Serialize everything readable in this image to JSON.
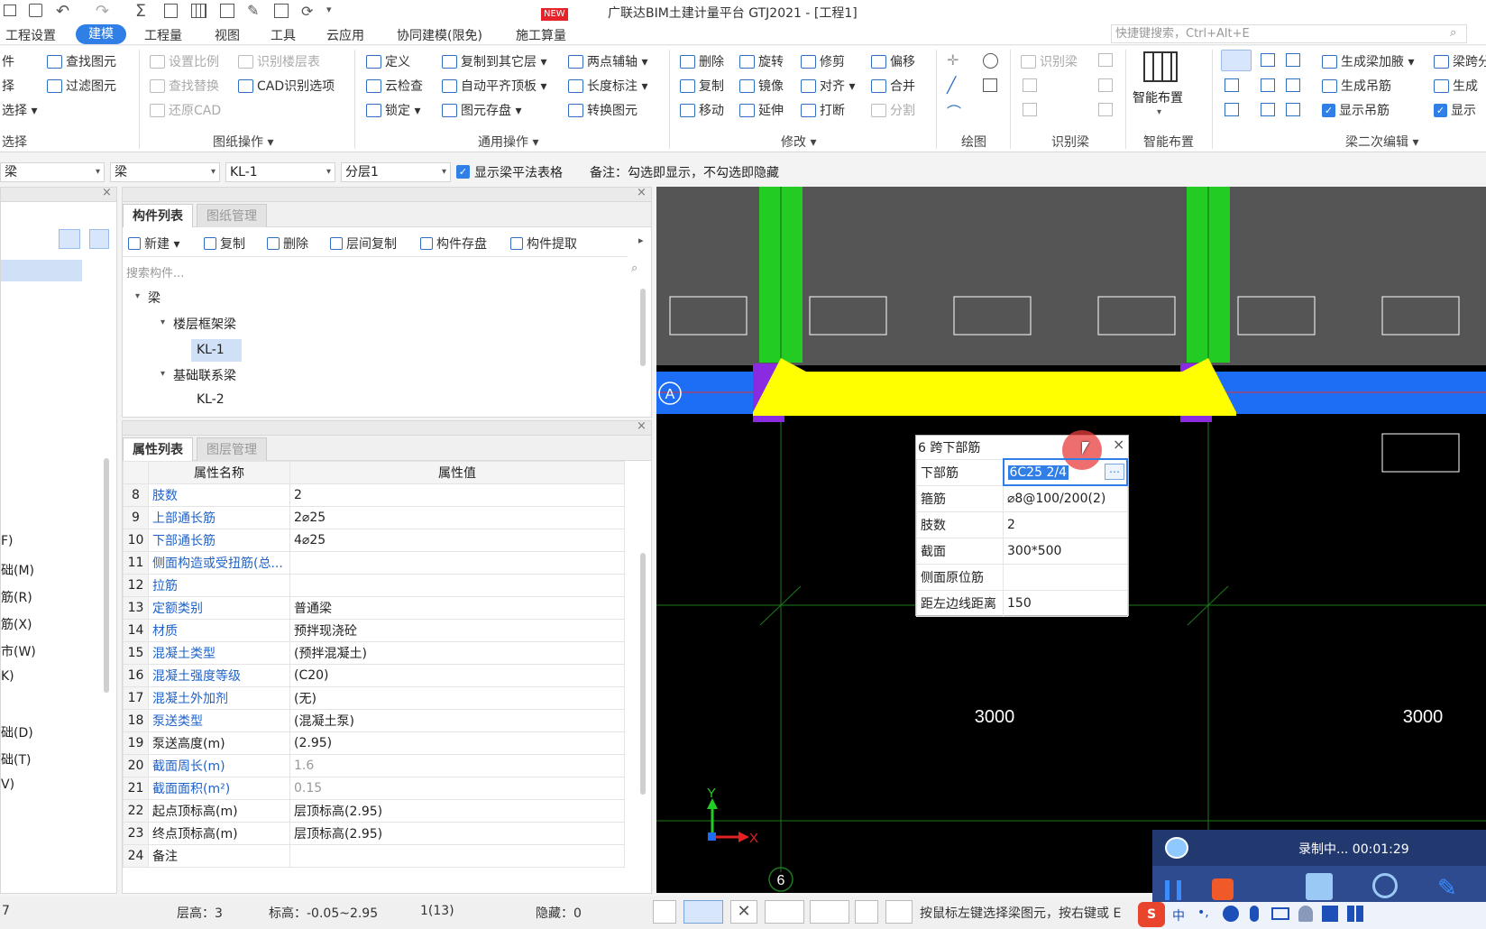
{
  "app": {
    "title": "广联达BIM土建计量平台 GTJ2021 - [工程1]",
    "new_badge": "NEW"
  },
  "menu": {
    "items": [
      "工程设置",
      "建模",
      "工程量",
      "视图",
      "工具",
      "云应用",
      "协同建模(限免)",
      "施工算量"
    ],
    "active": "建模",
    "search_placeholder": "快捷键搜索，Ctrl+Alt+E"
  },
  "ribbon": {
    "left_partial": [
      "件",
      "择",
      "选择 ▾",
      "选择"
    ],
    "find": [
      "查找图元",
      "过滤图元"
    ],
    "drawing_ops": {
      "items": [
        "设置比例",
        "识别楼层表",
        "查找替换",
        "CAD识别选项",
        "还原CAD"
      ],
      "label": "图纸操作 ▾"
    },
    "common_ops": {
      "items": [
        "定义",
        "复制到其它层 ▾",
        "两点辅轴 ▾",
        "云检查",
        "自动平齐顶板 ▾",
        "长度标注 ▾",
        "锁定 ▾",
        "图元存盘 ▾",
        "转换图元"
      ],
      "label": "通用操作 ▾"
    },
    "modify": {
      "items": [
        "删除",
        "旋转",
        "修剪",
        "偏移",
        "复制",
        "镜像",
        "对齐 ▾",
        "合并",
        "移动",
        "延伸",
        "打断",
        "分割"
      ],
      "label": "修改 ▾"
    },
    "draw": {
      "label": "绘图"
    },
    "recognize_beam": {
      "items": [
        "识别梁"
      ],
      "label": "识别梁"
    },
    "smart": {
      "button": "智能布置",
      "label": "智能布置"
    },
    "beam_edit": {
      "items": [
        "生成梁加腋 ▾",
        "梁跨分",
        "生成吊筋",
        "生成",
        "显示吊筋",
        "显示"
      ],
      "label": "梁二次编辑 ▾"
    }
  },
  "filterbar": {
    "combo1": "梁",
    "combo2": "梁",
    "combo3": "KL-1",
    "combo4": "分层1",
    "show_table_label": "显示梁平法表格",
    "note": "备注：勾选即显示，不勾选即隐藏"
  },
  "side_partial": [
    "F)",
    "础(M)",
    "筋(R)",
    "筋(X)",
    "市(W)",
    "K)",
    "础(D)",
    "础(T)",
    "V)"
  ],
  "component_panel": {
    "tabs": [
      "构件列表",
      "图纸管理"
    ],
    "tools": [
      "新建 ▾",
      "复制",
      "删除",
      "层间复制",
      "构件存盘",
      "构件提取"
    ],
    "search_placeholder": "搜索构件...",
    "tree": {
      "root": "梁",
      "groups": [
        {
          "name": "楼层框架梁",
          "children": [
            "KL-1"
          ]
        },
        {
          "name": "基础联系梁",
          "children": [
            "KL-2"
          ]
        }
      ],
      "selected": "KL-1"
    }
  },
  "property_panel": {
    "tabs": [
      "属性列表",
      "图层管理"
    ],
    "headers": [
      "属性名称",
      "属性值"
    ],
    "rows": [
      {
        "n": "8",
        "name": "肢数",
        "value": "2",
        "blue": true
      },
      {
        "n": "9",
        "name": "上部通长筋",
        "value": "2⌀25",
        "blue": true
      },
      {
        "n": "10",
        "name": "下部通长筋",
        "value": "4⌀25",
        "blue": true
      },
      {
        "n": "11",
        "name": "侧面构造或受扭筋(总...",
        "value": "",
        "blue": true
      },
      {
        "n": "12",
        "name": "拉筋",
        "value": "",
        "blue": true
      },
      {
        "n": "13",
        "name": "定额类别",
        "value": "普通梁",
        "blue": true
      },
      {
        "n": "14",
        "name": "材质",
        "value": "预拌现浇砼",
        "blue": true
      },
      {
        "n": "15",
        "name": "混凝土类型",
        "value": "(预拌混凝土)",
        "blue": true
      },
      {
        "n": "16",
        "name": "混凝土强度等级",
        "value": "(C20)",
        "blue": true
      },
      {
        "n": "17",
        "name": "混凝土外加剂",
        "value": "(无)",
        "blue": true
      },
      {
        "n": "18",
        "name": "泵送类型",
        "value": "(混凝土泵)",
        "blue": true
      },
      {
        "n": "19",
        "name": "泵送高度(m)",
        "value": "(2.95)",
        "blue": false
      },
      {
        "n": "20",
        "name": "截面周长(m)",
        "value": "1.6",
        "blue": true,
        "grey": true
      },
      {
        "n": "21",
        "name": "截面面积(m²)",
        "value": "0.15",
        "blue": true,
        "grey": true
      },
      {
        "n": "22",
        "name": "起点顶标高(m)",
        "value": "层顶标高(2.95)",
        "blue": false
      },
      {
        "n": "23",
        "name": "终点顶标高(m)",
        "value": "层顶标高(2.95)",
        "blue": false
      },
      {
        "n": "24",
        "name": "备注",
        "value": "",
        "blue": false
      }
    ]
  },
  "canvas": {
    "axis_label_a": "A",
    "axis_label_6": "6",
    "dim_left": "3000",
    "dim_right": "3000",
    "ucs_x": "X",
    "ucs_y": "Y",
    "colors": {
      "beam": "#ffff00",
      "column": "#22cc22",
      "wall": "#1e6ef5",
      "grid": "#1d7a1d",
      "support": "#8a2be2"
    }
  },
  "popup": {
    "title": "6 跨下部筋",
    "rows": [
      {
        "label": "下部筋",
        "value": "6C25 2/4",
        "editing": true
      },
      {
        "label": "箍筋",
        "value": "⌀8@100/200(2)"
      },
      {
        "label": "肢数",
        "value": "2"
      },
      {
        "label": "截面",
        "value": "300*500"
      },
      {
        "label": "侧面原位筋",
        "value": ""
      },
      {
        "label": "距左边线距离",
        "value": "150"
      }
    ]
  },
  "statusbar": {
    "left": "7",
    "floor_height": "层高：3",
    "elevation": "标高：-0.05~2.95",
    "count": "1(13)",
    "hidden": "隐藏：0",
    "hint": "按鼠标左键选择梁图元，按右键或 E"
  },
  "recorder": {
    "status": "录制中... 00:01:29",
    "ime": "中"
  }
}
